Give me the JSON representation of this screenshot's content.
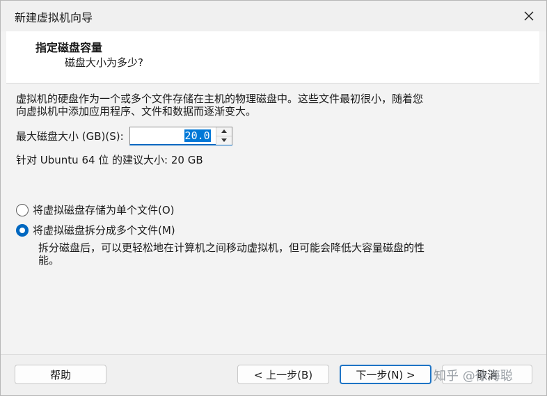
{
  "window": {
    "title": "新建虚拟机向导",
    "close_icon": "close-icon"
  },
  "header": {
    "title": "指定磁盘容量",
    "subtitle": "磁盘大小为多少?"
  },
  "content": {
    "description_line1": "虚拟机的硬盘作为一个或多个文件存储在主机的物理磁盘中。这些文件最初很小，随着您",
    "description_line2": "向虚拟机中添加应用程序、文件和数据而逐渐变大。",
    "max_size_label": "最大磁盘大小 (GB)(S):",
    "max_size_value": "20.0",
    "recommend_text": "针对 Ubuntu 64 位 的建议大小: 20 GB",
    "options": [
      {
        "label": "将虚拟磁盘存储为单个文件(O)",
        "selected": false
      },
      {
        "label": "将虚拟磁盘拆分成多个文件(M)",
        "selected": true
      }
    ],
    "split_note_line1": "拆分磁盘后，可以更轻松地在计算机之间移动虚拟机，但可能会降低大容量磁盘的性",
    "split_note_line2": "能。"
  },
  "footer": {
    "help_label": "帮助",
    "back_label": "< 上一步(B)",
    "next_label": "下一步(N) >",
    "cancel_label": "取消"
  },
  "watermark": "知乎 @徐海聪",
  "colors": {
    "accent": "#0067c0",
    "selection": "#0078d7",
    "background": "#f3f3f3"
  }
}
